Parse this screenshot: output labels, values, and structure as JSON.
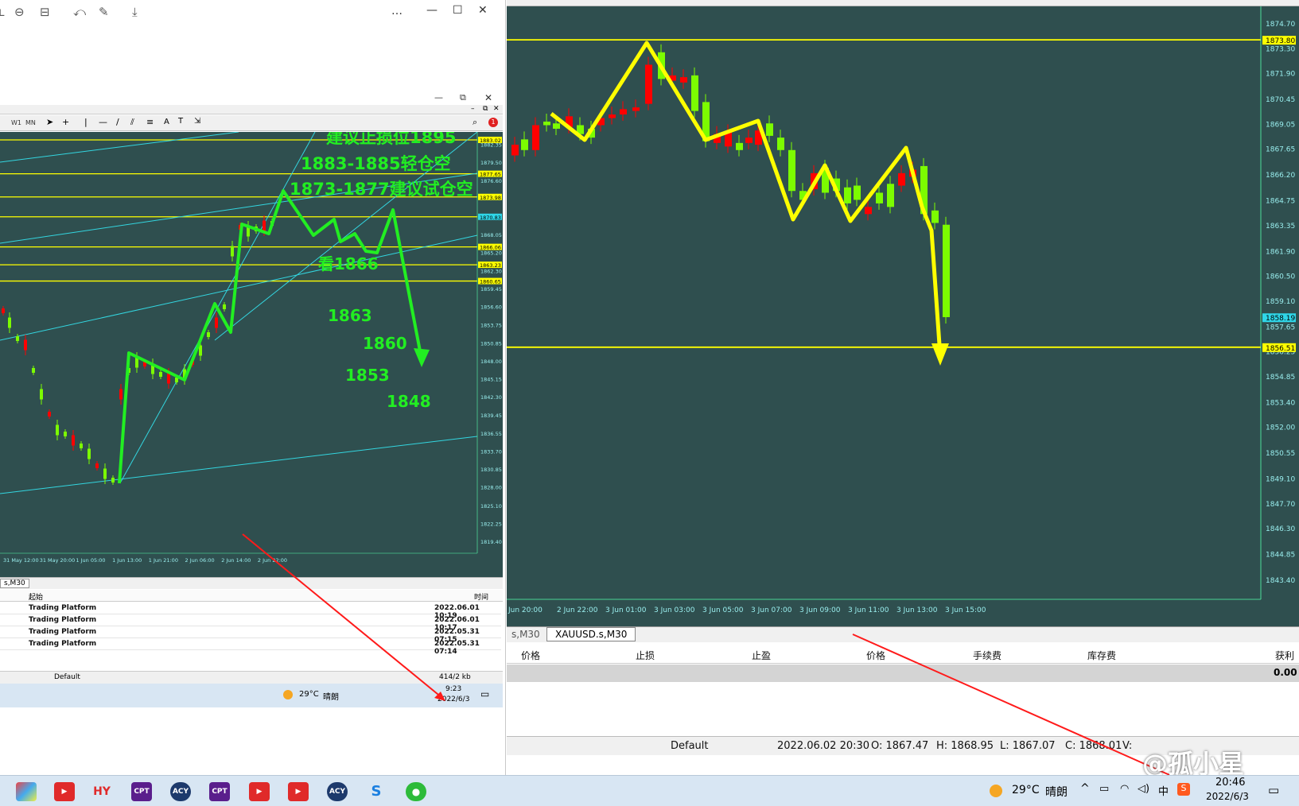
{
  "left_window": {
    "title_controls": [
      "…",
      "—",
      "☐",
      "✕"
    ],
    "toolbar_tf_labels": [
      "W1",
      "MN"
    ],
    "price_tags": [
      "1883.02",
      "1877.65",
      "1873.98",
      "1870.83",
      "1866.06",
      "1863.23",
      "1860.65"
    ],
    "price_axis": [
      "1882.35",
      "1879.50",
      "1876.60",
      "1871.05",
      "1868.05",
      "1865.20",
      "1862.30",
      "1859.45",
      "1856.60",
      "1853.75",
      "1850.85",
      "1848.00",
      "1845.15",
      "1842.30",
      "1839.45",
      "1836.55",
      "1833.70",
      "1830.85",
      "1828.00",
      "1825.10",
      "1822.25",
      "1819.40"
    ],
    "time_axis": [
      "31 May 12:00",
      "31 May 20:00",
      "1 Jun 05:00",
      "1 Jun 13:00",
      "1 Jun 21:00",
      "2 Jun 06:00",
      "2 Jun 14:00",
      "2 Jun 22:00"
    ],
    "annotations": {
      "stop_loss": "建议止损位1895",
      "light_short": "1883-1885轻仓空",
      "try_short": "1873-1877建议试仓空",
      "look": "看1866",
      "t1": "1863",
      "t2": "1860",
      "t3": "1853",
      "t4": "1848"
    },
    "tab_label": "s,M30",
    "journal": {
      "col_source": "起始",
      "col_time": "时间",
      "rows": [
        {
          "source": "Trading Platform",
          "time": "2022.06.01 10:19"
        },
        {
          "source": "Trading Platform",
          "time": "2022.06.01 10:17"
        },
        {
          "source": "Trading Platform",
          "time": "2022.05.31 07:15"
        },
        {
          "source": "Trading Platform",
          "time": "2022.05.31 07:14"
        }
      ]
    },
    "status": {
      "profile": "Default",
      "traffic": "414/2 kb"
    },
    "mini_tray": {
      "temp": "29°C",
      "weather": "晴朗",
      "time": "9:23",
      "date": "2022/6/3"
    }
  },
  "right_window": {
    "price_tags": {
      "top": "1873.80",
      "mid": "1858.19",
      "bottom": "1856.51"
    },
    "price_axis": [
      "1874.70",
      "1873.30",
      "1871.90",
      "1870.45",
      "1869.05",
      "1867.65",
      "1866.20",
      "1864.75",
      "1863.35",
      "1861.90",
      "1860.50",
      "1859.10",
      "1857.65",
      "1856.25",
      "1854.85",
      "1853.40",
      "1852.00",
      "1850.55",
      "1849.10",
      "1847.70",
      "1846.30",
      "1844.85",
      "1843.40"
    ],
    "time_axis": [
      "Jun 20:00",
      "2 Jun 22:00",
      "3 Jun 01:00",
      "3 Jun 03:00",
      "3 Jun 05:00",
      "3 Jun 07:00",
      "3 Jun 09:00",
      "3 Jun 11:00",
      "3 Jun 13:00",
      "3 Jun 15:00"
    ],
    "tabs": [
      "s,M30",
      "XAUUSD.s,M30"
    ],
    "trade_cols": [
      "价格",
      "止损",
      "止盈",
      "价格",
      "手续费",
      "库存费",
      "获利"
    ],
    "total": "0.00",
    "status": {
      "profile": "Default",
      "datetime": "2022.06.02 20:30",
      "open": "O: 1867.47",
      "high": "H: 1868.95",
      "low": "L: 1867.07",
      "close": "C: 1868.01",
      "vol": "V:"
    }
  },
  "taskbar": {
    "apps": [
      "HY",
      "CPT",
      "ACY",
      "CPT",
      "ACY"
    ],
    "temp": "29°C",
    "weather": "晴朗",
    "ime": "中",
    "time": "20:46",
    "date": "2022/6/3",
    "watermark": "@孤小星"
  },
  "colors": {
    "chart_bg": "#2f4f4f",
    "grid_line": "#ffff00",
    "channel": "#33d6e0",
    "bull": "#7cfc00",
    "bear": "#ff0000",
    "arrow_green": "#22ee22",
    "arrow_yellow": "#ffff00"
  }
}
